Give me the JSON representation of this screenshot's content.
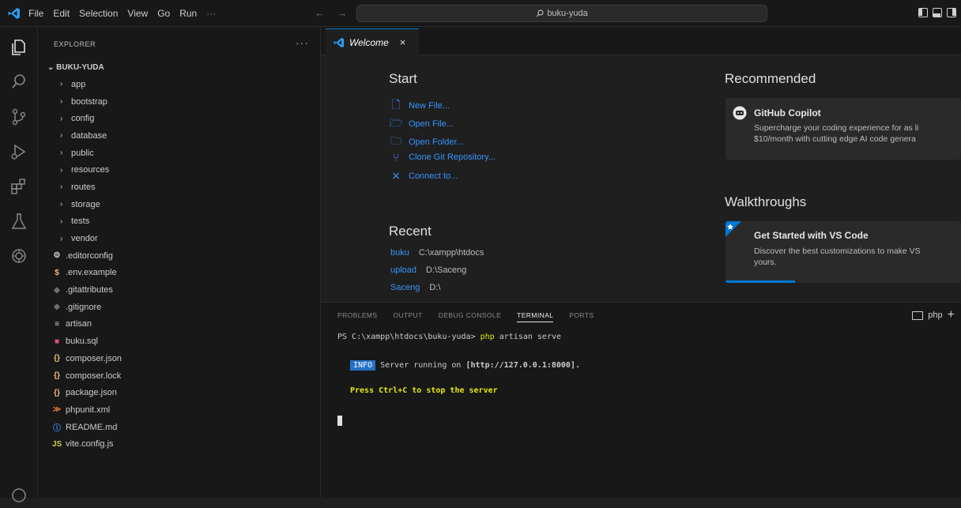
{
  "titlebar": {
    "menu": [
      "File",
      "Edit",
      "Selection",
      "View",
      "Go",
      "Run",
      "···"
    ],
    "nav_arrows": "← →",
    "search_text": "buku-yuda"
  },
  "sidebar": {
    "title": "EXPLORER",
    "more": "···",
    "root": "BUKU-YUDA",
    "items": [
      {
        "label": "app",
        "type": "folder"
      },
      {
        "label": "bootstrap",
        "type": "folder"
      },
      {
        "label": "config",
        "type": "folder"
      },
      {
        "label": "database",
        "type": "folder"
      },
      {
        "label": "public",
        "type": "folder"
      },
      {
        "label": "resources",
        "type": "folder"
      },
      {
        "label": "routes",
        "type": "folder"
      },
      {
        "label": "storage",
        "type": "folder"
      },
      {
        "label": "tests",
        "type": "folder"
      },
      {
        "label": "vendor",
        "type": "folder"
      },
      {
        "label": ".editorconfig",
        "type": "file",
        "icon": "⚙",
        "color": "#cccccc"
      },
      {
        "label": ".env.example",
        "type": "file",
        "icon": "$",
        "color": "#e5c07b"
      },
      {
        "label": ".gitattributes",
        "type": "file",
        "icon": "◆",
        "color": "#6e6e6e"
      },
      {
        "label": ".gitignore",
        "type": "file",
        "icon": "◆",
        "color": "#6e6e6e"
      },
      {
        "label": "artisan",
        "type": "file",
        "icon": "≡",
        "color": "#cccccc"
      },
      {
        "label": "buku.sql",
        "type": "file",
        "icon": "■",
        "color": "#e04f7f"
      },
      {
        "label": "composer.json",
        "type": "file",
        "icon": "{}",
        "color": "#e5c07b"
      },
      {
        "label": "composer.lock",
        "type": "file",
        "icon": "{}",
        "color": "#e5c07b"
      },
      {
        "label": "package.json",
        "type": "file",
        "icon": "{}",
        "color": "#e5c07b"
      },
      {
        "label": "phpunit.xml",
        "type": "file",
        "icon": "≫",
        "color": "#e37933"
      },
      {
        "label": "README.md",
        "type": "file",
        "icon": "ⓘ",
        "color": "#3794ff"
      },
      {
        "label": "vite.config.js",
        "type": "file",
        "icon": "JS",
        "color": "#cbcb41"
      }
    ]
  },
  "tab": {
    "label": "Welcome",
    "close": "×"
  },
  "welcome": {
    "start_title": "Start",
    "actions": [
      {
        "label": "New File...",
        "icon": "new-file-icon"
      },
      {
        "label": "Open File...",
        "icon": "open-file-icon"
      },
      {
        "label": "Open Folder...",
        "icon": "open-folder-icon"
      },
      {
        "label": "Clone Git Repository...",
        "icon": "git-clone-icon"
      },
      {
        "label": "Connect to...",
        "icon": "remote-connect-icon"
      }
    ],
    "recent_title": "Recent",
    "recent": [
      {
        "name": "buku",
        "path": "C:\\xampp\\htdocs"
      },
      {
        "name": "upload",
        "path": "D:\\Saceng"
      },
      {
        "name": "Saceng",
        "path": "D:\\"
      }
    ],
    "recommended_title": "Recommended",
    "copilot": {
      "title": "GitHub Copilot",
      "desc1": "Supercharge your coding experience for as li",
      "desc2": "$10/month with cutting edge AI code genera"
    },
    "walkthroughs_title": "Walkthroughs",
    "walk": {
      "title": "Get Started with VS Code",
      "desc1": "Discover the best customizations to make VS",
      "desc2": "yours."
    }
  },
  "panel": {
    "tabs": [
      "PROBLEMS",
      "OUTPUT",
      "DEBUG CONSOLE",
      "TERMINAL",
      "PORTS"
    ],
    "active_tab": "TERMINAL",
    "shell": "php",
    "plus": "+",
    "terminal": {
      "prompt": "PS C:\\xampp\\htdocs\\buku-yuda>",
      "cmd_php": "php",
      "cmd_rest": "artisan serve",
      "info_badge": "INFO",
      "info_text": "Server running on",
      "info_url": "[http://127.0.0.1:8000].",
      "stop_msg": "Press Ctrl+C to stop the server"
    }
  }
}
